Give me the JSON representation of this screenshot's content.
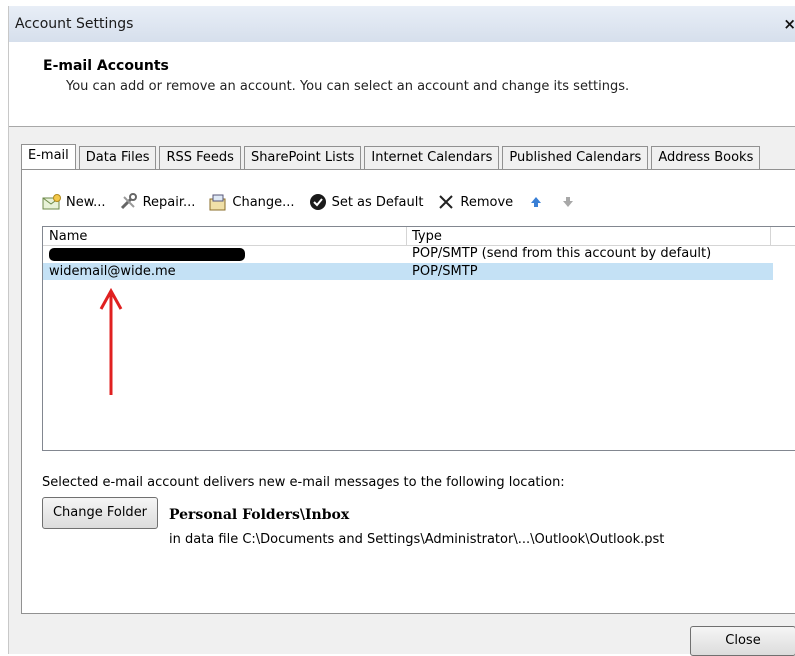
{
  "window": {
    "title": "Account Settings",
    "close_symbol": "×"
  },
  "header": {
    "title": "E-mail Accounts",
    "subtitle": "You can add or remove an account. You can select an account and change its settings."
  },
  "tabs": [
    {
      "label": "E-mail",
      "active": true
    },
    {
      "label": "Data Files"
    },
    {
      "label": "RSS Feeds"
    },
    {
      "label": "SharePoint Lists"
    },
    {
      "label": "Internet Calendars"
    },
    {
      "label": "Published Calendars"
    },
    {
      "label": "Address Books"
    }
  ],
  "toolbar": {
    "new": "New...",
    "repair": "Repair...",
    "change": "Change...",
    "set_default": "Set as Default",
    "remove": "Remove"
  },
  "list": {
    "columns": [
      "Name",
      "Type"
    ],
    "rows": [
      {
        "name": "",
        "type": "POP/SMTP (send from this account by default)",
        "redacted": true
      },
      {
        "name": "widemail@wide.me",
        "type": "POP/SMTP",
        "selected": true
      }
    ]
  },
  "delivery": {
    "text": "Selected e-mail account delivers new e-mail messages to the following location:",
    "change_folder": "Change Folder",
    "folder": "Personal Folders\\Inbox",
    "data_file": "in data file C:\\Documents and Settings\\Administrator\\...\\Outlook\\Outlook.pst"
  },
  "footer": {
    "close": "Close"
  },
  "colors": {
    "selection": "#c4e1f5",
    "annotation_arrow": "#e02020"
  },
  "icons": [
    "new-mail-icon",
    "repair-icon",
    "change-icon",
    "set-default-check-icon",
    "remove-x-icon",
    "move-up-icon",
    "move-down-icon"
  ]
}
